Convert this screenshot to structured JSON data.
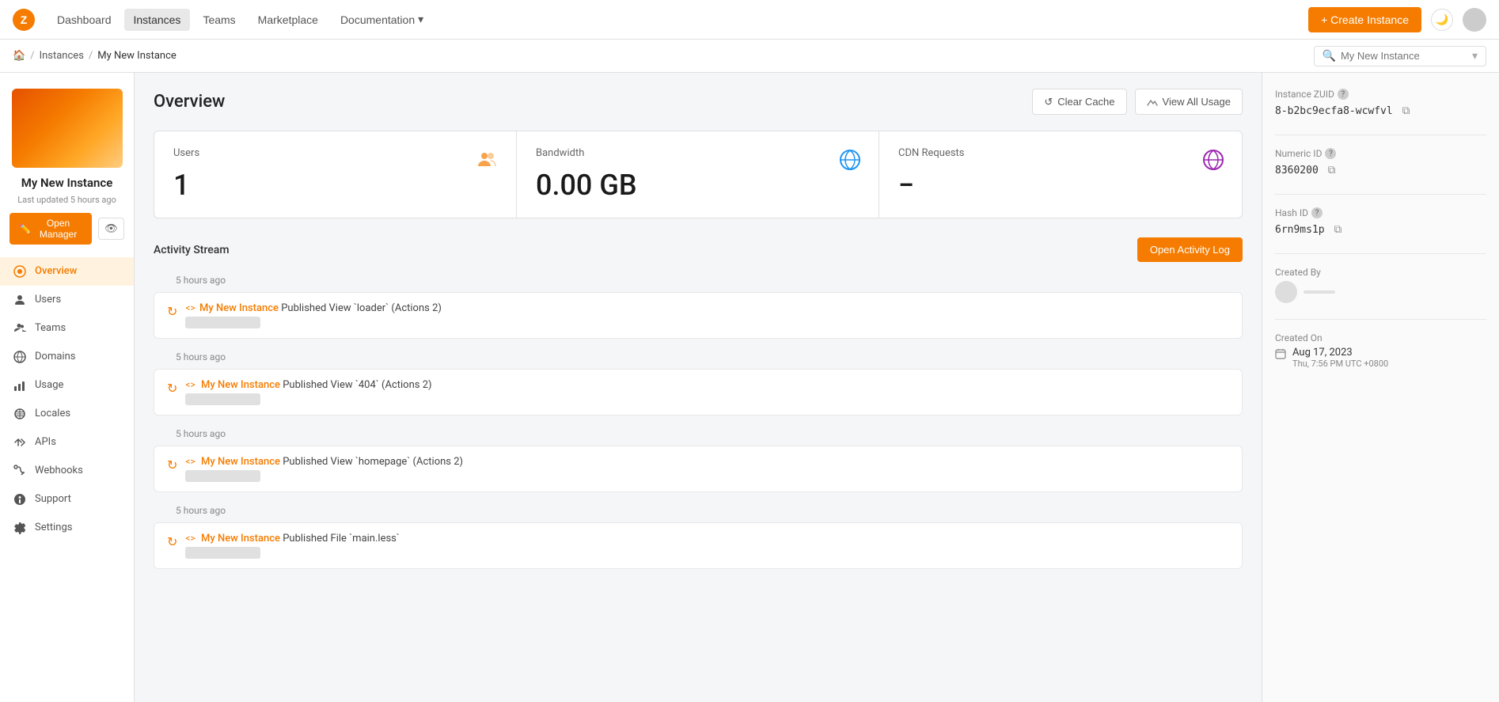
{
  "app": {
    "logo": "Z",
    "logo_color": "#f57c00"
  },
  "nav": {
    "links": [
      {
        "label": "Dashboard",
        "active": false,
        "id": "dashboard"
      },
      {
        "label": "Instances",
        "active": true,
        "id": "instances"
      },
      {
        "label": "Teams",
        "active": false,
        "id": "teams"
      },
      {
        "label": "Marketplace",
        "active": false,
        "id": "marketplace"
      },
      {
        "label": "Documentation",
        "active": false,
        "id": "documentation",
        "has_arrow": true
      }
    ],
    "create_button": "+ Create Instance",
    "search_placeholder": "My New Instance"
  },
  "breadcrumb": {
    "home_icon": "🏠",
    "items": [
      "Instances",
      "My New Instance"
    ]
  },
  "sidebar": {
    "instance_name": "My New Instance",
    "last_updated": "Last updated 5 hours ago",
    "open_manager_label": "Open Manager",
    "nav_items": [
      {
        "label": "Overview",
        "active": true,
        "icon": "overview"
      },
      {
        "label": "Users",
        "active": false,
        "icon": "users"
      },
      {
        "label": "Teams",
        "active": false,
        "icon": "teams"
      },
      {
        "label": "Domains",
        "active": false,
        "icon": "domains"
      },
      {
        "label": "Usage",
        "active": false,
        "icon": "usage"
      },
      {
        "label": "Locales",
        "active": false,
        "icon": "locales"
      },
      {
        "label": "APIs",
        "active": false,
        "icon": "apis"
      },
      {
        "label": "Webhooks",
        "active": false,
        "icon": "webhooks"
      },
      {
        "label": "Support",
        "active": false,
        "icon": "support"
      },
      {
        "label": "Settings",
        "active": false,
        "icon": "settings"
      }
    ]
  },
  "overview": {
    "title": "Overview",
    "clear_cache_label": "Clear Cache",
    "view_all_usage_label": "View All Usage",
    "stats": [
      {
        "label": "Users",
        "value": "1",
        "icon": "users-icon"
      },
      {
        "label": "Bandwidth",
        "value": "0.00 GB",
        "icon": "globe-icon"
      },
      {
        "label": "CDN Requests",
        "value": "−",
        "icon": "globe-purple-icon"
      }
    ]
  },
  "activity": {
    "title": "Activity Stream",
    "open_log_label": "Open Activity Log",
    "groups": [
      {
        "time": "5 hours ago",
        "items": [
          {
            "action": "Published View `loader` (Actions 2)",
            "instance": "My New Instance",
            "sub": "blurred-email"
          }
        ]
      },
      {
        "time": "5 hours ago",
        "items": [
          {
            "action": "Published View `404` (Actions 2)",
            "instance": "My New Instance",
            "sub": "blurred-email"
          }
        ]
      },
      {
        "time": "5 hours ago",
        "items": [
          {
            "action": "Published View `homepage` (Actions 2)",
            "instance": "My New Instance",
            "sub": "blurred-email"
          }
        ]
      },
      {
        "time": "5 hours ago",
        "items": [
          {
            "action": "Published File `main.less`",
            "instance": "My New Instance",
            "sub": "blurred-email"
          }
        ]
      }
    ]
  },
  "instance_info": {
    "zuid_label": "Instance ZUID",
    "zuid_value": "8-b2bc9ecfa8-wcwfvl",
    "numeric_id_label": "Numeric ID",
    "numeric_id_value": "8360200",
    "hash_id_label": "Hash ID",
    "hash_id_value": "6rn9ms1p",
    "created_by_label": "Created By",
    "created_on_label": "Created On",
    "created_date": "Aug 17, 2023",
    "created_date_sub": "Thu, 7:56 PM UTC +0800"
  },
  "colors": {
    "orange": "#f57c00",
    "light_orange_bg": "#fff3e0"
  }
}
